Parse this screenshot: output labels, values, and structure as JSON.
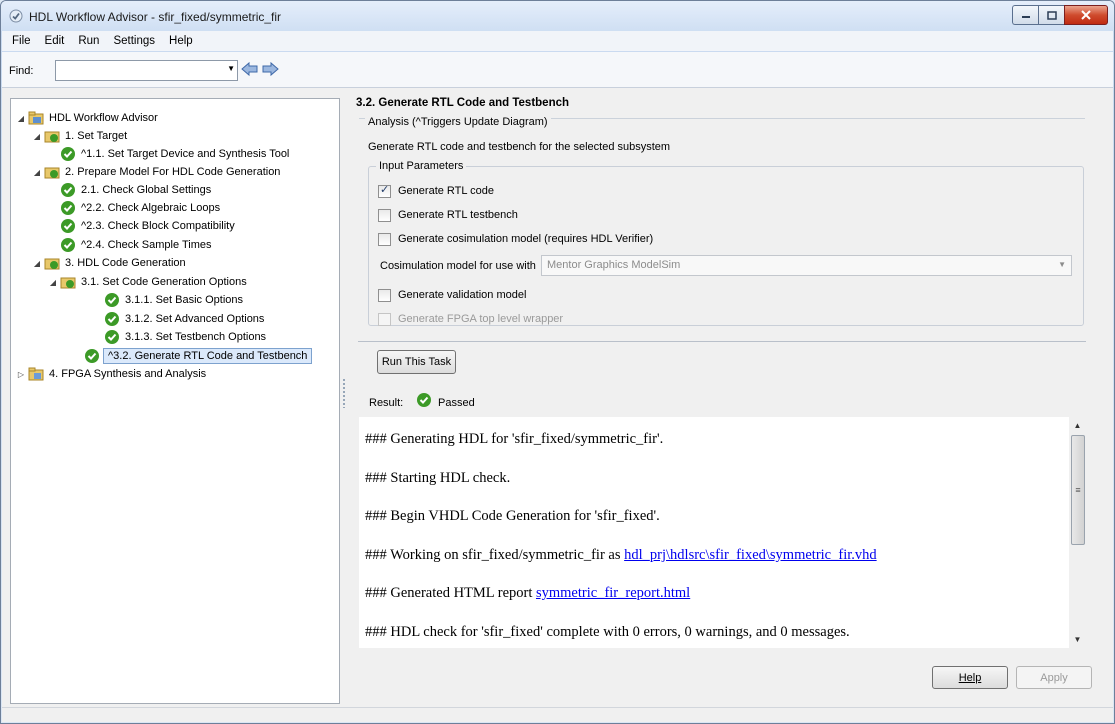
{
  "window": {
    "title": "HDL Workflow Advisor - sfir_fixed/symmetric_fir"
  },
  "menu": [
    "File",
    "Edit",
    "Run",
    "Settings",
    "Help"
  ],
  "find": {
    "label": "Find:",
    "value": ""
  },
  "tree": {
    "root": "HDL Workflow Advisor",
    "items": [
      {
        "label": "1. Set Target",
        "icon": "folder-check-icon"
      },
      {
        "label": "^1.1. Set Target Device and Synthesis Tool",
        "icon": "passed-check-icon"
      },
      {
        "label": "2. Prepare Model For HDL Code Generation",
        "icon": "folder-check-icon"
      },
      {
        "label": "2.1. Check Global Settings",
        "icon": "passed-check-icon"
      },
      {
        "label": "^2.2. Check Algebraic Loops",
        "icon": "passed-check-icon"
      },
      {
        "label": "^2.3. Check Block Compatibility",
        "icon": "passed-check-icon"
      },
      {
        "label": "^2.4. Check Sample Times",
        "icon": "passed-check-icon"
      },
      {
        "label": "3. HDL Code Generation",
        "icon": "folder-check-icon"
      },
      {
        "label": "3.1. Set Code Generation Options",
        "icon": "folder-check-icon"
      },
      {
        "label": "3.1.1. Set Basic Options",
        "icon": "passed-check-icon"
      },
      {
        "label": "3.1.2. Set Advanced Options",
        "icon": "passed-check-icon"
      },
      {
        "label": "3.1.3. Set Testbench Options",
        "icon": "passed-check-icon"
      },
      {
        "label": "^3.2. Generate RTL Code and Testbench",
        "icon": "passed-check-icon"
      },
      {
        "label": "4. FPGA Synthesis and Analysis",
        "icon": "folder-icon"
      }
    ]
  },
  "task": {
    "title": "3.2. Generate RTL Code and Testbench",
    "analysis_label": "Analysis (^Triggers Update Diagram)",
    "description": "Generate RTL code and testbench for the selected subsystem",
    "params_label": "Input Parameters",
    "options": [
      {
        "label": "Generate RTL code",
        "checked": true
      },
      {
        "label": "Generate RTL testbench",
        "checked": false
      },
      {
        "label": "Generate cosimulation model (requires HDL Verifier)",
        "checked": false
      },
      {
        "label": "Generate validation model",
        "checked": false
      },
      {
        "label": "Generate FPGA top level wrapper",
        "checked": false,
        "disabled": true
      }
    ],
    "cosim_label": "Cosimulation model for use with",
    "cosim_value": "Mentor Graphics ModelSim",
    "run_button": "Run This Task",
    "result_label": "Result:",
    "result_value": "Passed"
  },
  "log": {
    "lines": [
      "### Generating HDL for 'sfir_fixed/symmetric_fir'.",
      "### Starting HDL check.",
      "### Begin VHDL Code Generation for 'sfir_fixed'.",
      "### Working on sfir_fixed/symmetric_fir as ",
      "### Generated HTML report ",
      "### HDL check for 'sfir_fixed' complete with 0 errors, 0 warnings, and 0 messages."
    ],
    "link_vhd": "hdl_prj\\hdlsrc\\sfir_fixed\\symmetric_fir.vhd",
    "link_report": "symmetric_fir_report.html"
  },
  "buttons": {
    "help": "Help",
    "apply": "Apply"
  },
  "colors": {
    "check_green": "#3c9a27",
    "link": "#0000ee",
    "selection": "#dbe9fb"
  }
}
